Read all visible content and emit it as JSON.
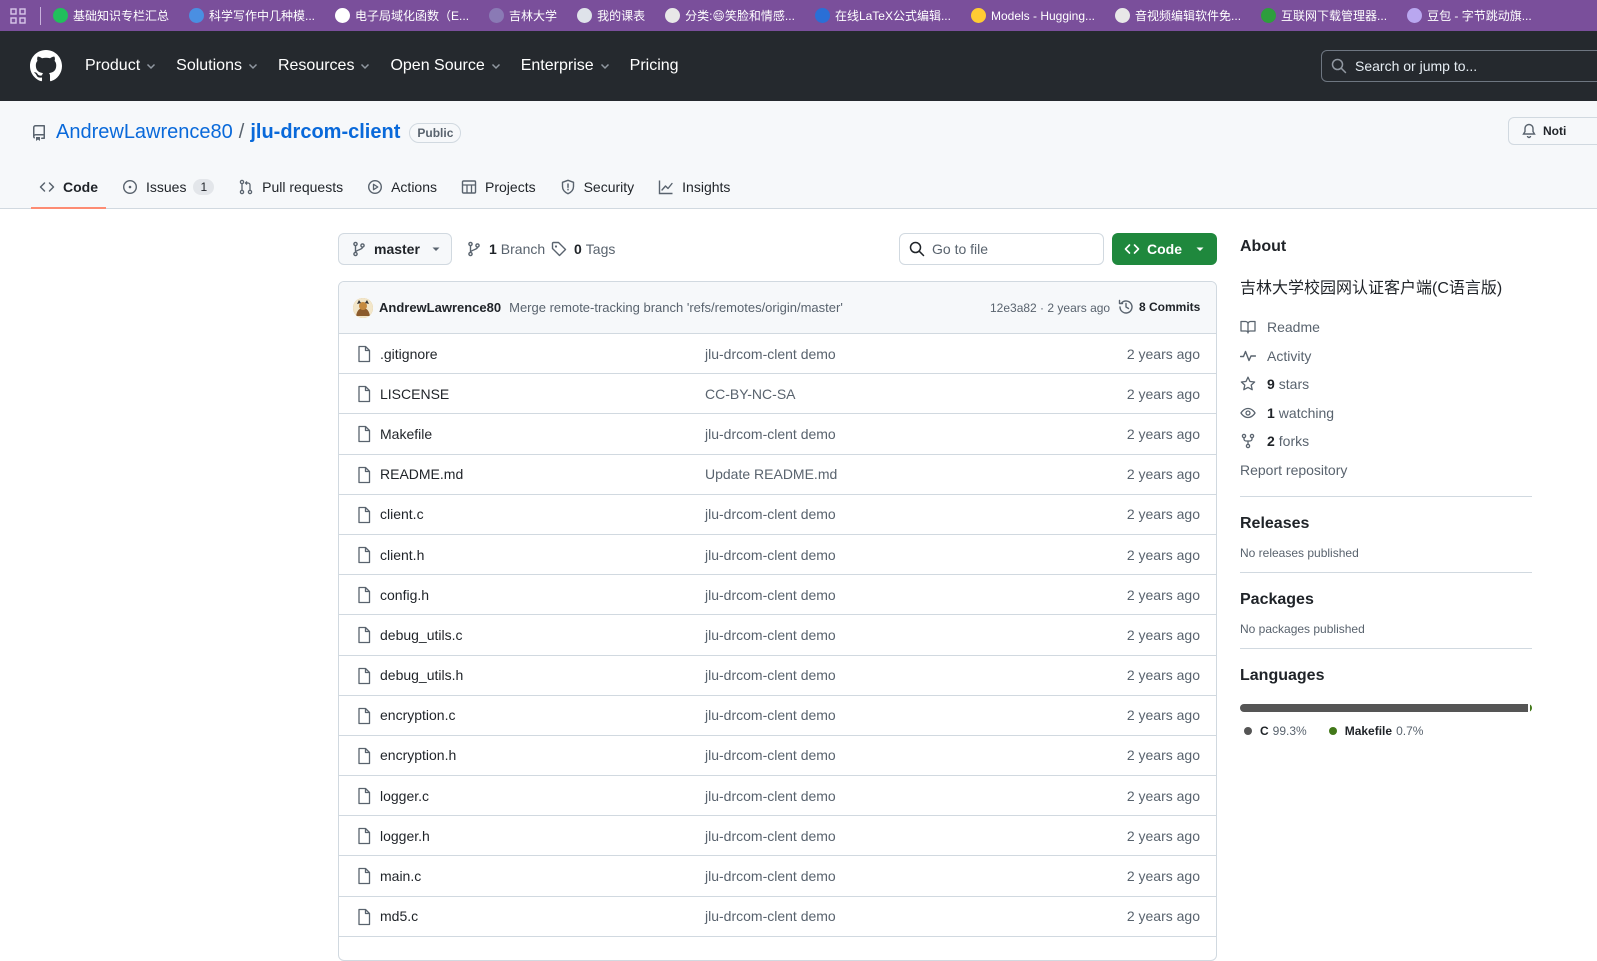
{
  "bookmarks": [
    {
      "label": "基础知识专栏汇总",
      "color": "#21c05c"
    },
    {
      "label": "科学写作中几种模...",
      "color": "#4a8fe2"
    },
    {
      "label": "电子局域化函数（E...",
      "color": "#ffffff"
    },
    {
      "label": "吉林大学",
      "color": "#8a7ab5"
    },
    {
      "label": "我的课表",
      "color": "#dfe3ea"
    },
    {
      "label": "分类:😄笑脸和情感...",
      "color": "#e8e8e8"
    },
    {
      "label": "在线LaTeX公式编辑...",
      "color": "#2a6fd6"
    },
    {
      "label": "Models - Hugging...",
      "color": "#ffcc33"
    },
    {
      "label": "音视频编辑软件免...",
      "color": "#e8e8e8"
    },
    {
      "label": "互联网下载管理器...",
      "color": "#2e9e3d"
    },
    {
      "label": "豆包 - 字节跳动旗...",
      "color": "#b9a7f0"
    }
  ],
  "header": {
    "nav": [
      "Product",
      "Solutions",
      "Resources",
      "Open Source",
      "Enterprise",
      "Pricing"
    ],
    "search_placeholder": "Search or jump to..."
  },
  "repo": {
    "owner": "AndrewLawrence80",
    "slash": "/",
    "name": "jlu-drcom-client",
    "visibility": "Public",
    "notifications_label": "Noti"
  },
  "tabs": [
    {
      "label": "Code",
      "icon": "code-icon"
    },
    {
      "label": "Issues",
      "icon": "issue-icon",
      "count": "1"
    },
    {
      "label": "Pull requests",
      "icon": "pull-request-icon"
    },
    {
      "label": "Actions",
      "icon": "play-icon"
    },
    {
      "label": "Projects",
      "icon": "table-icon"
    },
    {
      "label": "Security",
      "icon": "shield-icon"
    },
    {
      "label": "Insights",
      "icon": "graph-icon"
    }
  ],
  "toolbar": {
    "branch": "master",
    "branches_count": "1",
    "branches_label": "Branch",
    "tags_count": "0",
    "tags_label": "Tags",
    "goto_placeholder": "Go to file",
    "code_label": "Code"
  },
  "commit": {
    "author": "AndrewLawrence80",
    "message": "Merge remote-tracking branch 'refs/remotes/origin/master'",
    "meta": "12e3a82 · 2 years ago",
    "commits_label": "8 Commits"
  },
  "files": [
    {
      "name": ".gitignore",
      "message": "jlu-drcom-clent demo",
      "date": "2 years ago"
    },
    {
      "name": "LISCENSE",
      "message": "CC-BY-NC-SA",
      "date": "2 years ago"
    },
    {
      "name": "Makefile",
      "message": "jlu-drcom-clent demo",
      "date": "2 years ago"
    },
    {
      "name": "README.md",
      "message": "Update README.md",
      "date": "2 years ago"
    },
    {
      "name": "client.c",
      "message": "jlu-drcom-clent demo",
      "date": "2 years ago"
    },
    {
      "name": "client.h",
      "message": "jlu-drcom-clent demo",
      "date": "2 years ago"
    },
    {
      "name": "config.h",
      "message": "jlu-drcom-clent demo",
      "date": "2 years ago"
    },
    {
      "name": "debug_utils.c",
      "message": "jlu-drcom-clent demo",
      "date": "2 years ago"
    },
    {
      "name": "debug_utils.h",
      "message": "jlu-drcom-clent demo",
      "date": "2 years ago"
    },
    {
      "name": "encryption.c",
      "message": "jlu-drcom-clent demo",
      "date": "2 years ago"
    },
    {
      "name": "encryption.h",
      "message": "jlu-drcom-clent demo",
      "date": "2 years ago"
    },
    {
      "name": "logger.c",
      "message": "jlu-drcom-clent demo",
      "date": "2 years ago"
    },
    {
      "name": "logger.h",
      "message": "jlu-drcom-clent demo",
      "date": "2 years ago"
    },
    {
      "name": "main.c",
      "message": "jlu-drcom-clent demo",
      "date": "2 years ago"
    },
    {
      "name": "md5.c",
      "message": "jlu-drcom-clent demo",
      "date": "2 years ago"
    }
  ],
  "about": {
    "heading": "About",
    "description": "吉林大学校园网认证客户端(C语言版)",
    "readme": "Readme",
    "activity": "Activity",
    "stars_count": "9",
    "stars_label": "stars",
    "watching_count": "1",
    "watching_label": "watching",
    "forks_count": "2",
    "forks_label": "forks",
    "report": "Report repository"
  },
  "releases": {
    "heading": "Releases",
    "text": "No releases published"
  },
  "packages": {
    "heading": "Packages",
    "text": "No packages published"
  },
  "languages": {
    "heading": "Languages",
    "items": [
      {
        "name": "C",
        "percent": "99.3%",
        "value": 99.3,
        "color": "#555555"
      },
      {
        "name": "Makefile",
        "percent": "0.7%",
        "value": 0.7,
        "color": "#427819"
      }
    ]
  }
}
